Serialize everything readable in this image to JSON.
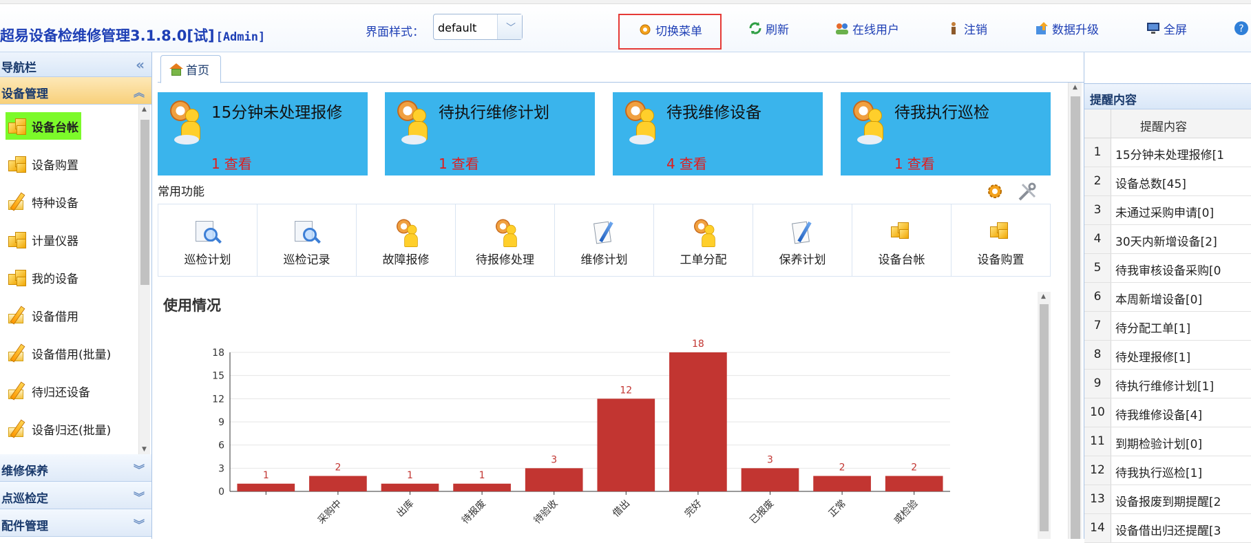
{
  "header": {
    "app_title": "超易设备检维修管理3.1.8.0[试]",
    "admin_label": "[Admin]",
    "style_label": "界面样式：",
    "style_value": "default",
    "buttons": {
      "switch_menu": "切换菜单",
      "refresh": "刷新",
      "online_users": "在线用户",
      "logout": "注销",
      "data_upgrade": "数据升级",
      "fullscreen": "全屏"
    }
  },
  "nav": {
    "title": "导航栏",
    "groups": {
      "device_mgmt": "设备管理",
      "maintenance": "维修保养",
      "inspection": "点巡检定",
      "parts": "配件管理"
    },
    "items": [
      {
        "label": "设备台帐",
        "icon": "boxes-icon"
      },
      {
        "label": "设备购置",
        "icon": "boxes-icon"
      },
      {
        "label": "特种设备",
        "icon": "pencil-icon"
      },
      {
        "label": "计量仪器",
        "icon": "boxes-icon"
      },
      {
        "label": "我的设备",
        "icon": "boxes-icon"
      },
      {
        "label": "设备借用",
        "icon": "pencil-icon"
      },
      {
        "label": "设备借用(批量)",
        "icon": "pencil-icon"
      },
      {
        "label": "待归还设备",
        "icon": "pencil-icon"
      },
      {
        "label": "设备归还(批量)",
        "icon": "pencil-icon"
      }
    ]
  },
  "tab": {
    "home": "首页"
  },
  "cards": [
    {
      "title": "15分钟未处理报修",
      "count": "1",
      "link": "查看"
    },
    {
      "title": "待执行维修计划",
      "count": "1",
      "link": "查看"
    },
    {
      "title": "待我维修设备",
      "count": "4",
      "link": "查看"
    },
    {
      "title": "待我执行巡检",
      "count": "1",
      "link": "查看"
    }
  ],
  "common": {
    "label": "常用功能",
    "functions": [
      {
        "label": "巡检计划",
        "icon": "magnifier-icon"
      },
      {
        "label": "巡检记录",
        "icon": "magnifier-icon"
      },
      {
        "label": "故障报修",
        "icon": "worker-icon"
      },
      {
        "label": "待报修处理",
        "icon": "worker-icon"
      },
      {
        "label": "维修计划",
        "icon": "document-pen-icon"
      },
      {
        "label": "工单分配",
        "icon": "worker-icon"
      },
      {
        "label": "保养计划",
        "icon": "document-pen-icon"
      },
      {
        "label": "设备台帐",
        "icon": "boxes-icon"
      },
      {
        "label": "设备购置",
        "icon": "boxes-icon"
      }
    ]
  },
  "chart_panel": {
    "title": "使用情况"
  },
  "chart_data": {
    "type": "bar",
    "title": "",
    "xlabel": "",
    "ylabel": "",
    "categories": [
      "",
      "采购中",
      "出库",
      "待报废",
      "待验收",
      "借出",
      "完好",
      "已报废",
      "正常",
      "或检验"
    ],
    "values": [
      1,
      2,
      1,
      1,
      3,
      12,
      18,
      3,
      2,
      2
    ],
    "ylim": [
      0,
      18
    ],
    "yticks": [
      0,
      3,
      6,
      9,
      12,
      15,
      18
    ],
    "grid": true,
    "legend": "none",
    "bar_color": "#c23531",
    "label_color": "#c23531"
  },
  "reminders": {
    "title": "提醒内容",
    "column": "提醒内容",
    "rows": [
      {
        "n": "1",
        "text": "15分钟未处理报修[1"
      },
      {
        "n": "2",
        "text": "设备总数[45]"
      },
      {
        "n": "3",
        "text": "未通过采购申请[0]"
      },
      {
        "n": "4",
        "text": "30天内新增设备[2]"
      },
      {
        "n": "5",
        "text": "待我审核设备采购[0"
      },
      {
        "n": "6",
        "text": "本周新增设备[0]"
      },
      {
        "n": "7",
        "text": "待分配工单[1]"
      },
      {
        "n": "8",
        "text": "待处理报修[1]"
      },
      {
        "n": "9",
        "text": "待执行维修计划[1]"
      },
      {
        "n": "10",
        "text": "待我维修设备[4]"
      },
      {
        "n": "11",
        "text": "到期检验计划[0]"
      },
      {
        "n": "12",
        "text": "待我执行巡检[1]"
      },
      {
        "n": "13",
        "text": "设备报废到期提醒[2"
      },
      {
        "n": "14",
        "text": "设备借出归还提醒[3"
      }
    ]
  }
}
